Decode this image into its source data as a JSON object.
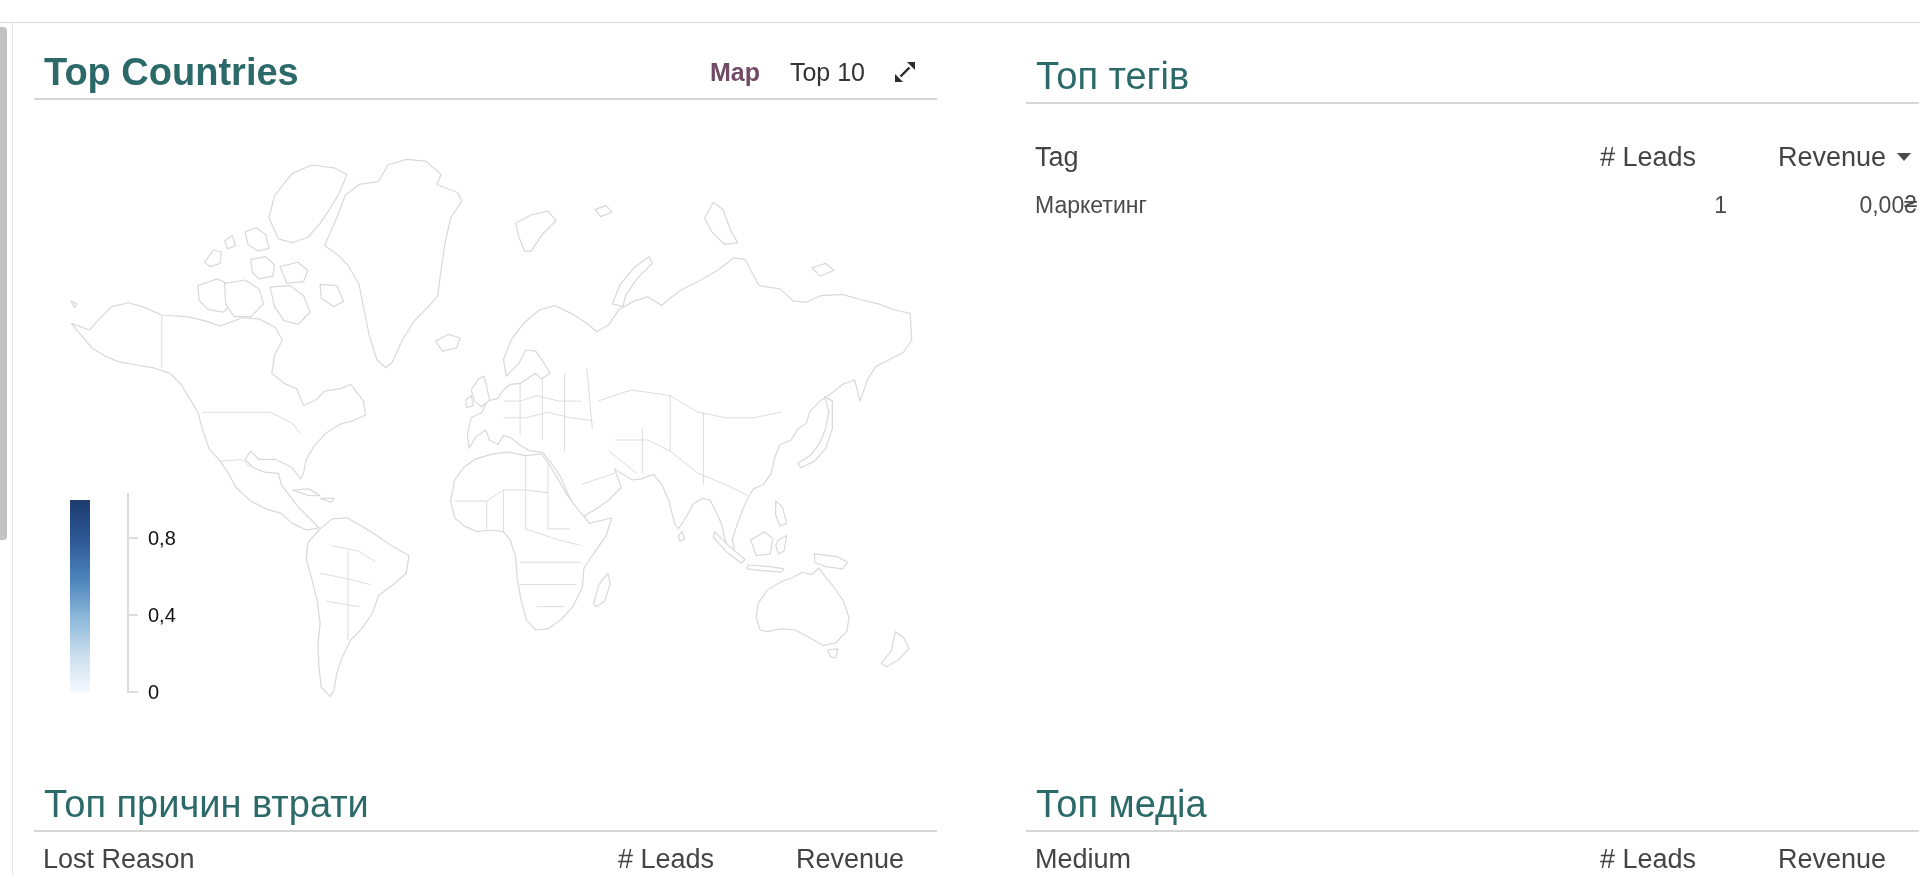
{
  "panels": [
    {
      "kind": "map",
      "title": "Top Countries",
      "views": [
        {
          "label": "Map",
          "selected": true
        },
        {
          "label": "Top 10",
          "selected": false
        }
      ],
      "legend": {
        "ticks": [
          "0,8",
          "0,4",
          "0"
        ]
      }
    },
    {
      "kind": "table",
      "title": "Топ тегів",
      "columns": [
        {
          "label": "Tag",
          "sorted": false
        },
        {
          "label": "# Leads",
          "sorted": false
        },
        {
          "label": "Revenue",
          "sorted": true
        }
      ],
      "rows": [
        [
          "Маркетинг",
          "1",
          "0,00₴"
        ]
      ]
    },
    {
      "kind": "table",
      "title": "Топ причин втрати",
      "columns": [
        {
          "label": "Lost Reason",
          "sorted": false
        },
        {
          "label": "# Leads",
          "sorted": false
        },
        {
          "label": "Revenue",
          "sorted": false
        }
      ]
    },
    {
      "kind": "table",
      "title": "Топ медіа",
      "columns": [
        {
          "label": "Medium",
          "sorted": false
        },
        {
          "label": "# Leads",
          "sorted": false
        },
        {
          "label": "Revenue",
          "sorted": false
        }
      ]
    }
  ]
}
